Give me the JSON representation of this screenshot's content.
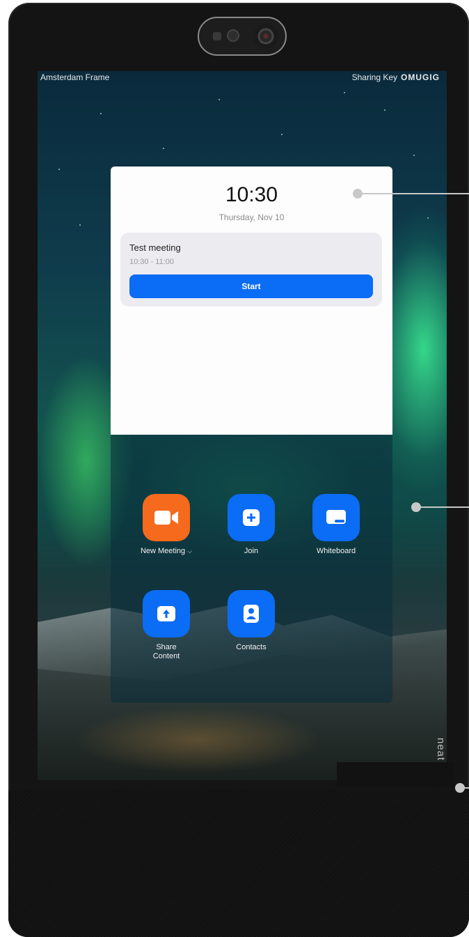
{
  "status_bar": {
    "device_name": "Amsterdam Frame",
    "sharing_label": "Sharing Key",
    "sharing_key": "OMUGIG"
  },
  "calendar": {
    "time": "10:30",
    "date": "Thursday, Nov 10",
    "meeting": {
      "title": "Test meeting",
      "time_range": "10:30 - 11:00",
      "start_label": "Start"
    }
  },
  "apps": [
    {
      "label": "New Meeting",
      "icon": "video-camera-icon",
      "color": "#f56a1c"
    },
    {
      "label": "Join",
      "icon": "plus-icon",
      "color": "#0b6cf5"
    },
    {
      "label": "Whiteboard",
      "icon": "whiteboard-icon",
      "color": "#0b6cf5"
    },
    {
      "label": "Share Content",
      "icon": "upload-icon",
      "color": "#0b6cf5"
    },
    {
      "label": "Contacts",
      "icon": "contact-icon",
      "color": "#0b6cf5"
    }
  ],
  "system_buttons": [
    {
      "icon": "lock-icon"
    },
    {
      "icon": "settings-gear-icon"
    }
  ],
  "hardware": {
    "brand": "neat"
  },
  "colors": {
    "accent_blue": "#0b6cf5",
    "accent_orange": "#f56a1c"
  }
}
